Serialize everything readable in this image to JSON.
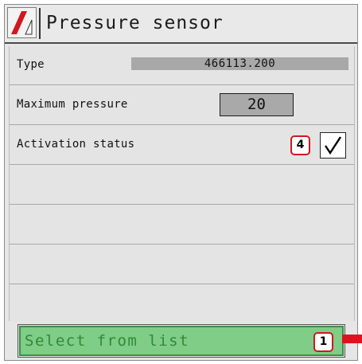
{
  "title": {
    "text": "Pressure sensor",
    "logo_icon": "red-slash-logo-icon"
  },
  "rows": {
    "type": {
      "label": "Type",
      "value": "466113.200"
    },
    "max_pressure": {
      "label": "Maximum pressure",
      "value": "20"
    },
    "activation": {
      "label": "Activation status",
      "badge": "4",
      "checked": true,
      "check_icon": "checkmark-icon"
    }
  },
  "bottom": {
    "select_label": "Select from list",
    "badge": "1"
  },
  "colors": {
    "accent_red": "#d3161f",
    "button_green": "#7fcd86",
    "button_text": "#2f8a38",
    "field_gray": "#a8a8a8"
  }
}
